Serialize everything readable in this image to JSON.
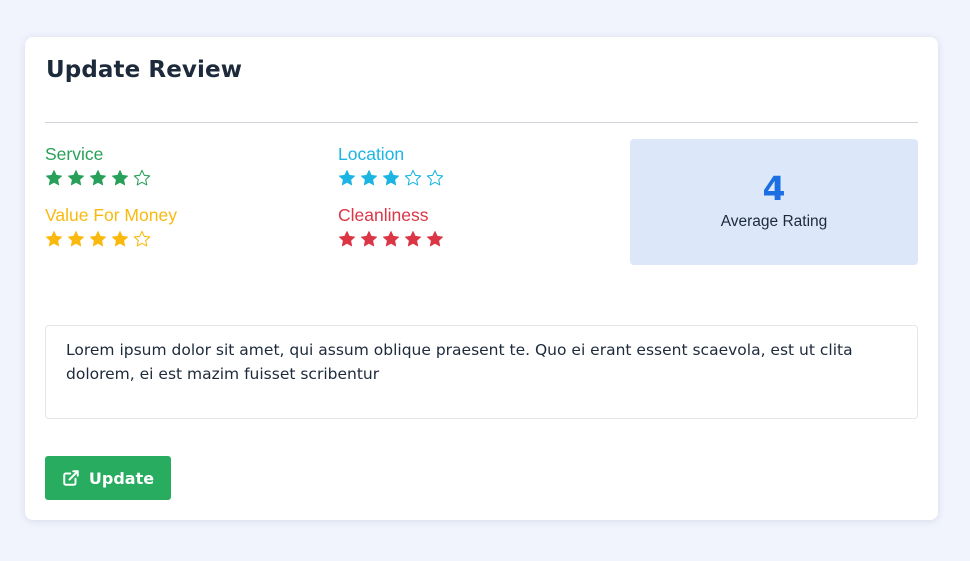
{
  "header": {
    "title": "Update Review"
  },
  "ratings": [
    {
      "label": "Service",
      "value": 4,
      "max": 5,
      "color": "#28a05a"
    },
    {
      "label": "Location",
      "value": 3,
      "max": 5,
      "color": "#1cb5e3"
    },
    {
      "label": "Value For Money",
      "value": 4,
      "max": 5,
      "color": "#f9b90e"
    },
    {
      "label": "Cleanliness",
      "value": 5,
      "max": 5,
      "color": "#dc3545"
    }
  ],
  "average": {
    "value": "4",
    "label": "Average Rating",
    "color": "#1c6fe3"
  },
  "comment": {
    "text": "Lorem ipsum dolor sit amet, qui assum oblique praesent te. Quo ei erant essent scaevola, est ut clita dolorem, ei est mazim fuisset scribentur"
  },
  "actions": {
    "update_label": "Update",
    "update_icon": "external-link-icon",
    "update_color": "#28ad60"
  }
}
